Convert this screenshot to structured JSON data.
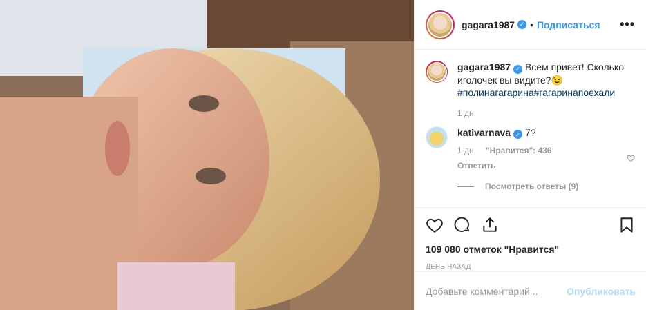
{
  "post": {
    "photo_label": "post-photo"
  },
  "header": {
    "username": "gagara1987",
    "dot": "•",
    "follow_label": "Подписаться",
    "more_label": "•••"
  },
  "caption": {
    "username": "gagara1987",
    "text": "Всем привет! Сколько иголочек вы видите?",
    "emoji": "😉",
    "hashtags": "#полинагагарина#гагаринапоехали",
    "time": "1 дн."
  },
  "comment": {
    "username": "kativarnava",
    "text": "7?",
    "time": "1 дн.",
    "likes": "\"Нравится\": 436",
    "reply_label": "Ответить",
    "view_replies_label": "Посмотреть ответы (9)"
  },
  "actions": {
    "likes_text": "109 080 отметок \"Нравится\"",
    "date": "день назад"
  },
  "add_comment": {
    "placeholder": "Добавьте комментарий...",
    "publish_label": "Опубликовать"
  }
}
